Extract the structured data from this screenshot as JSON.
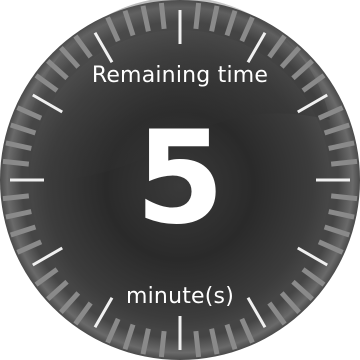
{
  "watch_face": {
    "title_label": "Remaining time",
    "remaining_value": "5",
    "unit_label": "minute(s)"
  },
  "colors": {
    "background": "#ffffff",
    "bezel": "#5a5a5a",
    "dial_center": "#2b2b2b",
    "text": "#ffffff",
    "tick": "#e6e6e6"
  },
  "icons": {
    "bezel_ticks": "watch-bezel-tick-marks"
  }
}
